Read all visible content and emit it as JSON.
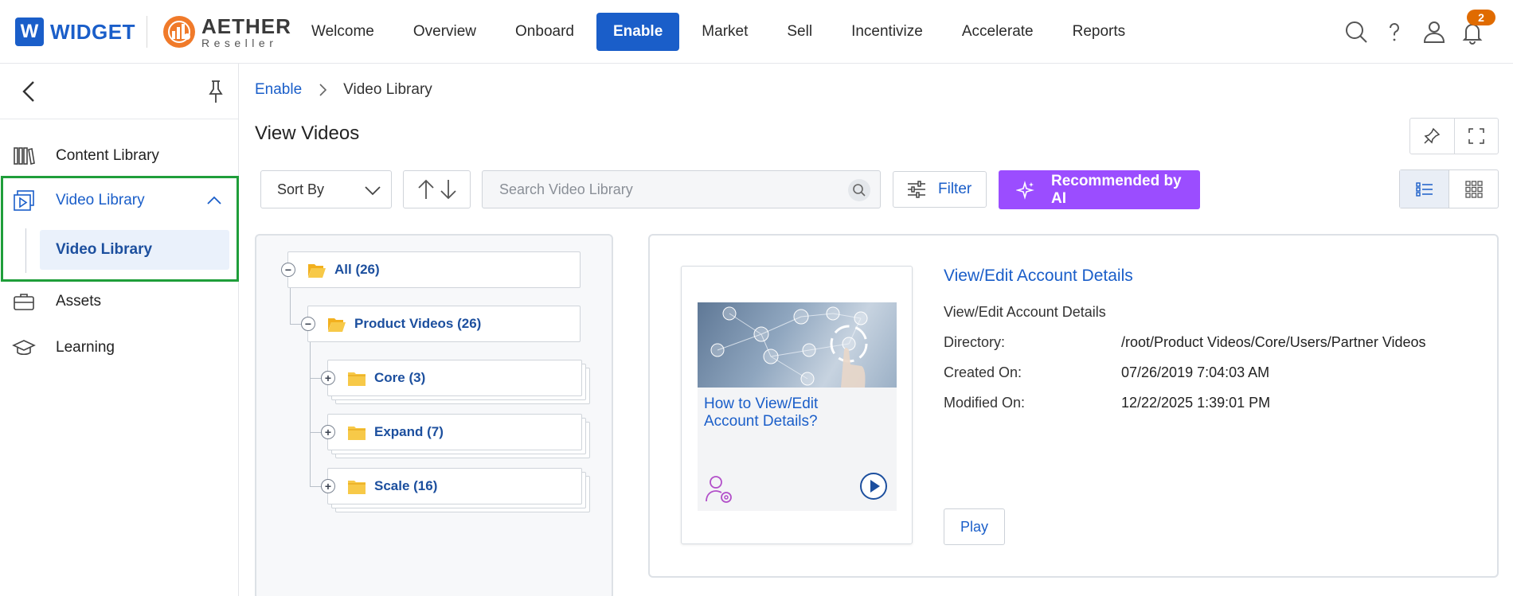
{
  "brand": {
    "widget_mark": "W",
    "widget_name": "WIDGET",
    "aether_name": "AETHER",
    "aether_sub": "Reseller",
    "primary_color": "#1a5ec9",
    "ai_color": "#9b4dff"
  },
  "nav": {
    "items": [
      {
        "label": "Welcome",
        "active": false
      },
      {
        "label": "Overview",
        "active": false
      },
      {
        "label": "Onboard",
        "active": false
      },
      {
        "label": "Enable",
        "active": true
      },
      {
        "label": "Market",
        "active": false
      },
      {
        "label": "Sell",
        "active": false
      },
      {
        "label": "Incentivize",
        "active": false
      },
      {
        "label": "Accelerate",
        "active": false
      },
      {
        "label": "Reports",
        "active": false
      }
    ]
  },
  "header_icons": {
    "search": "search-icon",
    "help": "help-icon",
    "user": "user-icon",
    "bell": "bell-icon",
    "notification_count": "2"
  },
  "sidebar": {
    "items": [
      {
        "label": "Content Library",
        "icon": "books-icon"
      },
      {
        "label": "Video Library",
        "icon": "video-library-icon",
        "expanded": true
      },
      {
        "label": "Assets",
        "icon": "briefcase-icon"
      },
      {
        "label": "Learning",
        "icon": "graduation-cap-icon"
      }
    ],
    "sub_items": [
      {
        "label": "Video Library",
        "selected": true
      }
    ]
  },
  "breadcrumb": {
    "parent": "Enable",
    "current": "Video Library"
  },
  "page": {
    "title": "View Videos"
  },
  "toolbar": {
    "sort_label": "Sort By",
    "search_placeholder": "Search Video Library",
    "filter_label": "Filter",
    "ai_label": "Recommended by AI"
  },
  "tree": {
    "root": {
      "label": "All (26)",
      "expanded": true
    },
    "group": {
      "label": "Product Videos (26)",
      "expanded": true
    },
    "children": [
      {
        "label": "Core (3)",
        "expanded": false
      },
      {
        "label": "Expand (7)",
        "expanded": false
      },
      {
        "label": "Scale (16)",
        "expanded": false
      }
    ]
  },
  "video": {
    "card_title": "How to View/Edit Account Details?",
    "title": "View/Edit Account Details",
    "description": "View/Edit Account Details",
    "fields": [
      {
        "label": "Directory:",
        "value": "/root/Product Videos/Core/Users/Partner Videos"
      },
      {
        "label": "Created On:",
        "value": "07/26/2019 7:04:03 AM"
      },
      {
        "label": "Modified On:",
        "value": "12/22/2025 1:39:01 PM"
      }
    ],
    "play_label": "Play"
  }
}
